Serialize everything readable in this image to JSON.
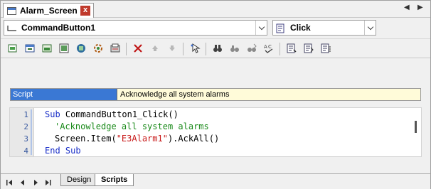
{
  "document_tab": {
    "title": "Alarm_Screen",
    "close_glyph": "x",
    "nav_left": "◀",
    "nav_right": "▶"
  },
  "selectors": {
    "object": {
      "value": "CommandButton1",
      "icon": "command-button-icon"
    },
    "event": {
      "value": "Click",
      "icon": "event-icon"
    }
  },
  "toolbar": {
    "groups": [
      [
        "insert-object-icon",
        "insert-screen-icon",
        "insert-picture-icon",
        "insert-frame-icon",
        "insert-app-icon",
        "insert-data-icon",
        "insert-server-icon",
        "insert-print-icon"
      ],
      [
        "delete-icon",
        "move-up-icon",
        "move-down-icon"
      ],
      [
        "pick-icon"
      ],
      [
        "find-icon",
        "replace-icon",
        "find-next-icon",
        "spell-check-icon"
      ],
      [
        "indent-icon",
        "outdent-icon",
        "comment-icon"
      ]
    ]
  },
  "script_header": {
    "label": "Script",
    "description": "Acknowledge all system alarms"
  },
  "code": {
    "line_numbers": [
      "1",
      "2",
      "3",
      "4"
    ],
    "lines": [
      {
        "kw1": "Sub",
        "rest": " CommandButton1_Click()"
      },
      {
        "comment": "'Acknowledge all system alarms"
      },
      {
        "pre": "Screen.Item(",
        "str": "\"E3Alarm1\"",
        "post": ").AckAll()"
      },
      {
        "kw1": "End",
        "mid": " ",
        "kw2": "Sub"
      }
    ]
  },
  "sheet_tabs": {
    "nav": [
      "|◀",
      "◀",
      "▶",
      "▶|"
    ],
    "tabs": [
      {
        "label": "Design",
        "active": false
      },
      {
        "label": "Scripts",
        "active": true
      }
    ]
  },
  "colors": {
    "keyword": "#1a2fc8",
    "comment": "#1a8a1a",
    "string": "#c81a1a",
    "script_label_bg": "#3a78d4",
    "description_bg": "#fffbd9",
    "close_button": "#c0392b"
  }
}
